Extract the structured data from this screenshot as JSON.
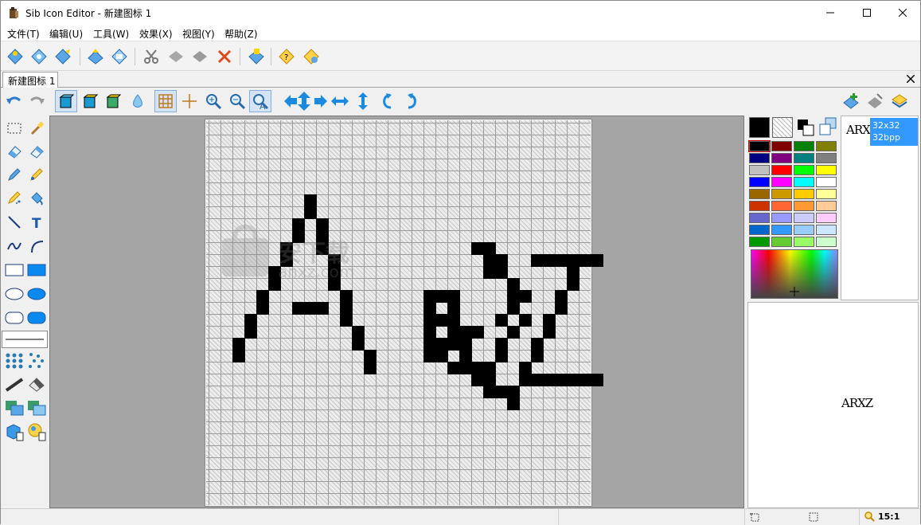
{
  "window": {
    "title": "Sib Icon Editor - 新建图标 1"
  },
  "menu": {
    "items": [
      "文件(T)",
      "编辑(U)",
      "工具(W)",
      "效果(X)",
      "视图(Y)",
      "帮助(Z)"
    ]
  },
  "document_tab": {
    "label": "新建图标 1"
  },
  "formats": {
    "selected_size": "32x32",
    "selected_depth": "32bpp",
    "thumbnail_text": "ARXZ"
  },
  "preview": {
    "text": "ARXZ"
  },
  "watermark": {
    "text": "安下载",
    "sub": "anxz.com"
  },
  "status": {
    "zoom": "15:1"
  },
  "colors": {
    "accent_selection": "#3399ff",
    "palette": [
      [
        "#000000",
        "#800000",
        "#008000",
        "#808000"
      ],
      [
        "#000080",
        "#800080",
        "#008080",
        "#808080"
      ],
      [
        "#c0c0c0",
        "#ff0000",
        "#00ff00",
        "#ffff00"
      ],
      [
        "#0000ff",
        "#ff00ff",
        "#00ffff",
        "#ffffff"
      ],
      [
        "#996600",
        "#cc9900",
        "#ffcc00",
        "#ffff99"
      ],
      [
        "#cc3300",
        "#ff6633",
        "#ff9933",
        "#ffcc99"
      ],
      [
        "#6666cc",
        "#9999ff",
        "#ccccff",
        "#ffccff"
      ],
      [
        "#0066cc",
        "#3399ff",
        "#99ccff",
        "#cce6ff"
      ],
      [
        "#009900",
        "#66cc33",
        "#99ff66",
        "#ccffcc"
      ]
    ],
    "primary": "#000000",
    "secondary": "transparent"
  },
  "icon_pixels": [
    [
      8,
      6
    ],
    [
      8,
      7
    ],
    [
      7,
      8
    ],
    [
      9,
      8
    ],
    [
      7,
      9
    ],
    [
      9,
      9
    ],
    [
      6,
      10
    ],
    [
      9,
      10
    ],
    [
      6,
      11
    ],
    [
      10,
      11
    ],
    [
      5,
      12
    ],
    [
      10,
      12
    ],
    [
      5,
      13
    ],
    [
      10,
      13
    ],
    [
      4,
      14
    ],
    [
      11,
      14
    ],
    [
      4,
      15
    ],
    [
      7,
      15
    ],
    [
      8,
      15
    ],
    [
      9,
      15
    ],
    [
      11,
      15
    ],
    [
      3,
      16
    ],
    [
      11,
      16
    ],
    [
      3,
      17
    ],
    [
      12,
      17
    ],
    [
      2,
      18
    ],
    [
      12,
      18
    ],
    [
      2,
      19
    ],
    [
      13,
      19
    ],
    [
      13,
      20
    ],
    [
      18,
      14
    ],
    [
      19,
      14
    ],
    [
      20,
      14
    ],
    [
      18,
      15
    ],
    [
      20,
      15
    ],
    [
      18,
      16
    ],
    [
      19,
      16
    ],
    [
      20,
      16
    ],
    [
      18,
      17
    ],
    [
      20,
      17
    ],
    [
      18,
      18
    ],
    [
      21,
      18
    ],
    [
      18,
      19
    ],
    [
      21,
      19
    ],
    [
      22,
      20
    ],
    [
      22,
      21
    ],
    [
      23,
      11
    ],
    [
      24,
      11
    ],
    [
      23,
      12
    ],
    [
      24,
      12
    ],
    [
      25,
      13
    ],
    [
      25,
      14
    ],
    [
      26,
      14
    ],
    [
      25,
      15
    ],
    [
      24,
      16
    ],
    [
      26,
      16
    ],
    [
      25,
      17
    ],
    [
      24,
      18
    ],
    [
      24,
      19
    ],
    [
      23,
      20
    ],
    [
      23,
      21
    ],
    [
      19,
      19
    ],
    [
      20,
      20
    ],
    [
      21,
      20
    ],
    [
      19,
      18
    ],
    [
      20,
      18
    ],
    [
      21,
      17
    ],
    [
      22,
      17
    ],
    [
      24,
      22
    ],
    [
      23,
      22
    ],
    [
      22,
      10
    ],
    [
      23,
      10
    ],
    [
      27,
      11
    ],
    [
      28,
      11
    ],
    [
      29,
      11
    ],
    [
      30,
      11
    ],
    [
      31,
      11
    ],
    [
      32,
      11
    ],
    [
      30,
      12
    ],
    [
      30,
      13
    ],
    [
      29,
      14
    ],
    [
      29,
      15
    ],
    [
      28,
      16
    ],
    [
      28,
      17
    ],
    [
      27,
      18
    ],
    [
      27,
      19
    ],
    [
      26,
      20
    ],
    [
      26,
      21
    ],
    [
      25,
      22
    ],
    [
      27,
      21
    ],
    [
      28,
      21
    ],
    [
      29,
      21
    ],
    [
      30,
      21
    ],
    [
      31,
      21
    ],
    [
      32,
      21
    ],
    [
      25,
      23
    ]
  ]
}
